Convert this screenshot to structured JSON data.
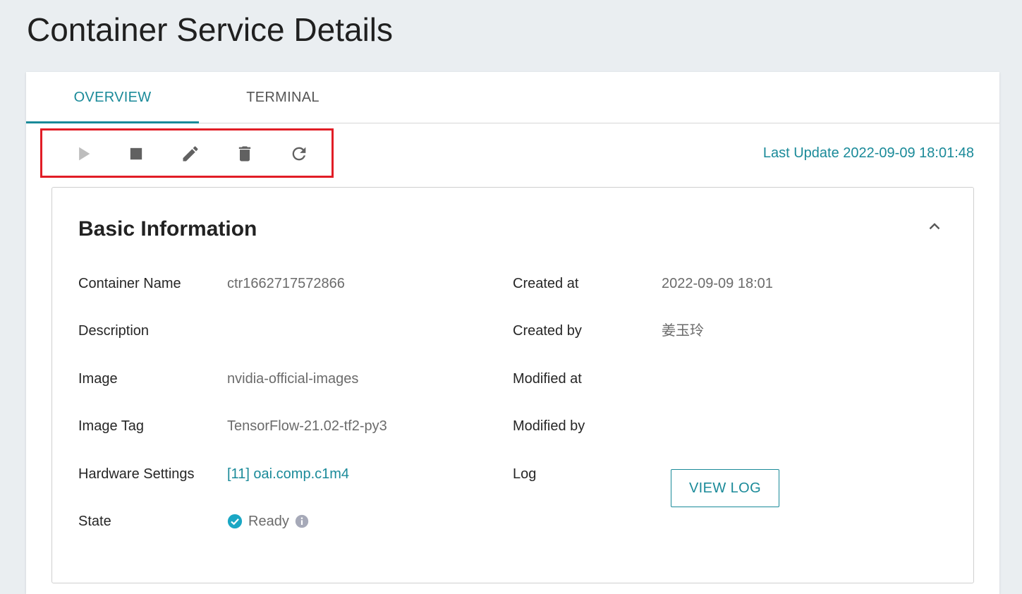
{
  "page": {
    "title": "Container Service Details"
  },
  "tabs": [
    {
      "label": "OVERVIEW",
      "active": true
    },
    {
      "label": "TERMINAL",
      "active": false
    }
  ],
  "toolbar": {
    "icons": [
      "play-icon",
      "stop-icon",
      "edit-icon",
      "delete-icon",
      "refresh-icon"
    ],
    "last_update": "Last Update 2022-09-09 18:01:48"
  },
  "basic_info": {
    "title": "Basic Information",
    "container_name_label": "Container Name",
    "container_name_value": "ctr1662717572866",
    "description_label": "Description",
    "description_value": "",
    "image_label": "Image",
    "image_value": "nvidia-official-images",
    "image_tag_label": "Image Tag",
    "image_tag_value": "TensorFlow-21.02-tf2-py3",
    "hardware_label": "Hardware Settings",
    "hardware_value": "[11] oai.comp.c1m4",
    "state_label": "State",
    "state_value": "Ready",
    "created_at_label": "Created at",
    "created_at_value": "2022-09-09 18:01",
    "created_by_label": "Created by",
    "created_by_value": "姜玉玲",
    "modified_at_label": "Modified at",
    "modified_at_value": "",
    "modified_by_label": "Modified by",
    "modified_by_value": "",
    "log_label": "Log",
    "view_log_label": "VIEW LOG"
  },
  "colors": {
    "accent": "#1a8a99",
    "highlight_border": "#e11d26",
    "ready": "#1aa7c4",
    "icon": "#616161",
    "icon_disabled": "#bdbdbd"
  }
}
